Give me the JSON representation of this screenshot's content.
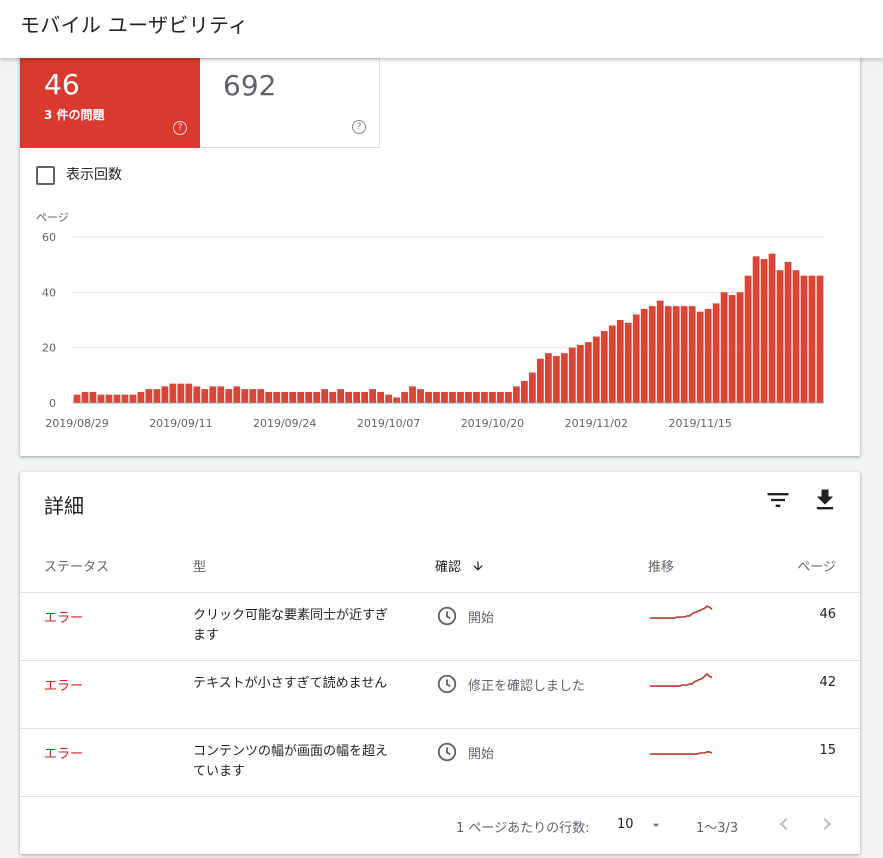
{
  "page": {
    "title": "モバイル ユーザビリティ"
  },
  "summary": {
    "error_count": "46",
    "error_label": "3 件の問題",
    "valid_count": "692",
    "help_glyph": "?",
    "impressions_label": "表示回数"
  },
  "colors": {
    "error": "#db4437",
    "error_text": "#c5221f",
    "grid": "#e0e0e0",
    "spark": "#b33b2e"
  },
  "chart_data": {
    "type": "bar",
    "ylabel": "ページ",
    "ylim": [
      0,
      60
    ],
    "yticks": [
      0,
      20,
      40,
      60
    ],
    "xtick_labels": [
      "2019/08/29",
      "2019/09/11",
      "2019/09/24",
      "2019/10/07",
      "2019/10/20",
      "2019/11/02",
      "2019/11/15"
    ],
    "xtick_indices": [
      0,
      13,
      26,
      39,
      52,
      65,
      78
    ],
    "grid": true,
    "series": [
      {
        "color": "#db4437",
        "values": [
          3,
          4,
          4,
          3,
          3,
          3,
          3,
          3,
          4,
          5,
          5,
          6,
          7,
          7,
          7,
          6,
          5,
          6,
          6,
          5,
          6,
          5,
          5,
          5,
          4,
          4,
          4,
          4,
          4,
          4,
          4,
          5,
          4,
          5,
          4,
          4,
          4,
          5,
          4,
          3,
          2,
          4,
          6,
          5,
          4,
          4,
          4,
          4,
          4,
          4,
          4,
          4,
          4,
          4,
          4,
          6,
          8,
          11,
          16,
          18,
          17,
          18,
          20,
          21,
          22,
          24,
          26,
          28,
          30,
          29,
          32,
          34,
          35,
          37,
          35,
          35,
          35,
          35,
          33,
          34,
          36,
          40,
          39,
          40,
          46,
          53,
          52,
          54,
          48,
          51,
          48,
          46,
          46,
          46
        ]
      }
    ]
  },
  "details": {
    "title": "詳細",
    "filter_icon": "filter-icon",
    "download_icon": "download-icon",
    "columns": {
      "status": "ステータス",
      "type": "型",
      "validation": "確認",
      "trend": "推移",
      "pages": "ページ"
    },
    "rows": [
      {
        "status": "エラー",
        "type": "クリック可能な要素同士が近すぎます",
        "validation": "開始",
        "pages": "46",
        "trend": [
          10,
          10,
          10,
          10,
          10,
          10,
          10,
          10,
          10,
          10,
          10,
          11,
          11,
          11,
          11,
          12,
          12,
          14,
          15,
          16,
          17,
          18,
          19,
          21,
          20,
          18
        ]
      },
      {
        "status": "エラー",
        "type": "テキストが小さすぎて読めません",
        "validation": "修正を確認しました",
        "pages": "42",
        "trend": [
          10,
          10,
          10,
          10,
          10,
          10,
          10,
          10,
          10,
          10,
          10,
          10,
          10,
          11,
          11,
          11,
          12,
          12,
          14,
          15,
          16,
          17,
          19,
          21,
          19,
          18
        ]
      },
      {
        "status": "エラー",
        "type": "コンテンツの幅が画面の幅を超えています",
        "validation": "開始",
        "pages": "15",
        "trend": [
          10,
          10,
          10,
          10,
          10,
          10,
          10,
          10,
          10,
          10,
          10,
          10,
          10,
          10,
          10,
          10,
          10,
          10,
          10,
          10,
          11,
          11,
          11,
          12,
          12,
          11
        ]
      }
    ],
    "footer": {
      "rows_per_page_label": "1 ページあたりの行数:",
      "rows_per_page": "10",
      "range": "1～3/3"
    }
  }
}
